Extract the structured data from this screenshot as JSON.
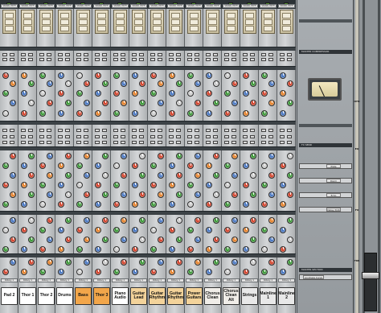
{
  "strip_top_label": "SIGNAL PATH",
  "channels": [
    {
      "name": "Pad 2",
      "bottom": "Rotary 1",
      "color": "#ffffff"
    },
    {
      "name": "Thor 1",
      "bottom": "Rotary 1",
      "color": "#ffffff"
    },
    {
      "name": "Thor 2",
      "bottom": "Rotary 1",
      "color": "#ffffff"
    },
    {
      "name": "Drums",
      "bottom": "Rotary 1",
      "color": "#ffffff"
    },
    {
      "name": "Bass",
      "bottom": "Rotary 1",
      "color": "#f2a64a"
    },
    {
      "name": "Thor 3",
      "bottom": "Rotary 1",
      "color": "#f2a64a"
    },
    {
      "name": "Piano Audio",
      "bottom": "Rotary 1",
      "color": "#ffffff"
    },
    {
      "name": "Guitar Lead",
      "bottom": "Rotary 1",
      "color": "#f3d39a"
    },
    {
      "name": "Guitar Rhythm",
      "bottom": "Rotary 1",
      "color": "#f3d39a"
    },
    {
      "name": "Guitar Rhythm",
      "bottom": "Rotary 1",
      "color": "#f3d39a"
    },
    {
      "name": "Power Guitars",
      "bottom": "Rotary 1",
      "color": "#f3d39a"
    },
    {
      "name": "Chorus Clean",
      "bottom": "Rotary 1",
      "color": "#f0ede8"
    },
    {
      "name": "Chorus Clean Alt",
      "bottom": "Rotary 1",
      "color": "#f0ede8"
    },
    {
      "name": "Strings",
      "bottom": "Rotary 1",
      "color": "#e8e8e8"
    },
    {
      "name": "Mainline 1",
      "bottom": "Rotary 1",
      "color": "#e8e8e8"
    },
    {
      "name": "Mainline 2",
      "bottom": "Rotary 1",
      "color": "#e8e8e8"
    }
  ],
  "master": {
    "compressor_title": "MASTER COMPRESSOR",
    "fx_title": "FX SEND",
    "master_section": "MASTER SECTION",
    "fx_labels": [
      "Plate",
      "Room",
      "Echo",
      "Delay 3/16"
    ],
    "loudness": "Loudness Curve"
  },
  "rack_labels": [
    "DYN",
    "EQ",
    "FX",
    "FDR"
  ]
}
